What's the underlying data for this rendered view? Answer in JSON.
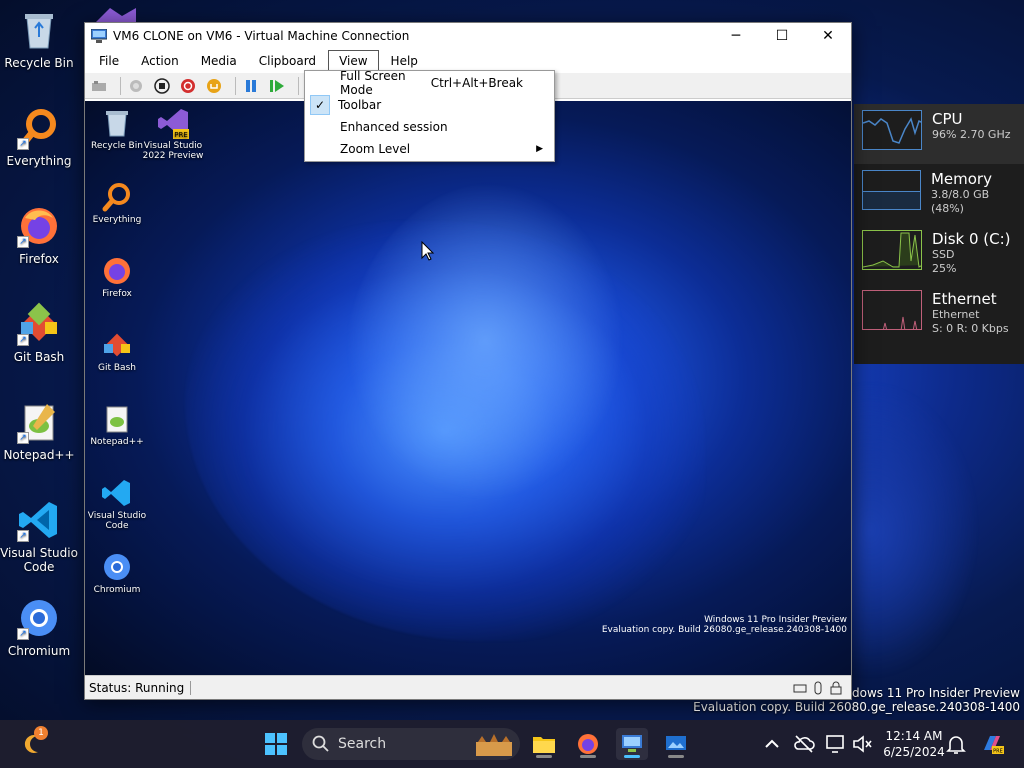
{
  "desktop": {
    "icons": [
      {
        "label": "Recycle Bin"
      },
      {
        "label": "Everything"
      },
      {
        "label": "Firefox"
      },
      {
        "label": "Git Bash"
      },
      {
        "label": "Notepad++"
      },
      {
        "label": "Visual Studio Code"
      },
      {
        "label": "Chromium"
      }
    ],
    "watermark_line1": "Windows 11 Pro Insider Preview",
    "watermark_line2": "Evaluation copy. Build 26080.ge_release.240308-1400"
  },
  "vm_window": {
    "title": "VM6 CLONE on VM6 - Virtual Machine Connection",
    "menus": [
      "File",
      "Action",
      "Media",
      "Clipboard",
      "View",
      "Help"
    ],
    "active_menu": "View",
    "status": "Status: Running",
    "guest": {
      "icons": [
        {
          "label": "Recycle Bin"
        },
        {
          "label": "Visual Studio 2022 Preview"
        },
        {
          "label": "Everything"
        },
        {
          "label": "Firefox"
        },
        {
          "label": "Git Bash"
        },
        {
          "label": "Notepad++"
        },
        {
          "label": "Visual Studio Code"
        },
        {
          "label": "Chromium"
        }
      ],
      "watermark_line1": "Windows 11 Pro Insider Preview",
      "watermark_line2": "Evaluation copy. Build 26080.ge_release.240308-1400"
    }
  },
  "view_menu": {
    "items": [
      {
        "label": "Full Screen Mode",
        "shortcut": "Ctrl+Alt+Break",
        "checked": false
      },
      {
        "label": "Toolbar",
        "shortcut": "",
        "checked": true
      },
      {
        "label": "Enhanced session",
        "shortcut": "",
        "checked": false
      },
      {
        "label": "Zoom Level",
        "shortcut": "",
        "checked": false,
        "submenu": true
      }
    ]
  },
  "perf_widget": {
    "cpu": {
      "title": "CPU",
      "detail": "96% 2.70 GHz"
    },
    "memory": {
      "title": "Memory",
      "detail": "3.8/8.0 GB (48%)"
    },
    "disk": {
      "title": "Disk 0 (C:)",
      "type": "SSD",
      "usage": "25%"
    },
    "ethernet": {
      "title": "Ethernet",
      "name": "Ethernet",
      "rate": "S: 0 R: 0 Kbps"
    }
  },
  "taskbar": {
    "search_placeholder": "Search",
    "time": "12:14 AM",
    "date": "6/25/2024",
    "notification_badge": "1"
  },
  "colors": {
    "accent": "#4cc2ff",
    "cpu_graph": "#4a86c8",
    "disk_graph": "#8bc34a",
    "eth_graph": "#c0607a"
  }
}
